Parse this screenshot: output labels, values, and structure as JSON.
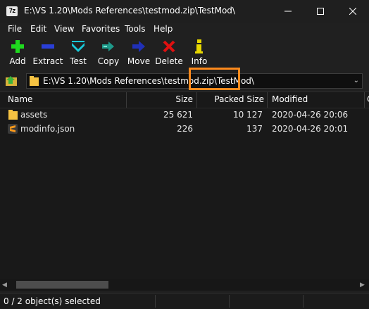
{
  "window": {
    "title": "E:\\VS 1.20\\Mods References\\testmod.zip\\TestMod\\",
    "app_icon_text": "7z"
  },
  "window_controls": {
    "minimize": "—",
    "maximize": "☐",
    "close": "✕"
  },
  "menu": [
    "File",
    "Edit",
    "View",
    "Favorites",
    "Tools",
    "Help"
  ],
  "toolbar": [
    {
      "label": "Add",
      "icon": "plus-icon",
      "color": "#1fd91f"
    },
    {
      "label": "Extract",
      "icon": "minus-icon",
      "color": "#2a3fd8"
    },
    {
      "label": "Test",
      "icon": "check-icon",
      "color": "#19c8d8"
    },
    {
      "label": "Copy",
      "icon": "double-arrow-icon",
      "color": "#1e9a8a"
    },
    {
      "label": "Move",
      "icon": "arrow-right-icon",
      "color": "#2030b8"
    },
    {
      "label": "Delete",
      "icon": "x-icon",
      "color": "#e01010"
    },
    {
      "label": "Info",
      "icon": "info-icon",
      "color": "#e8d800"
    }
  ],
  "address": {
    "path": "E:\\VS 1.20\\Mods References\\testmod.zip\\TestMod\\"
  },
  "columns": {
    "name": "Name",
    "size": "Size",
    "packed": "Packed Size",
    "modified": "Modified",
    "extra": "C"
  },
  "files": [
    {
      "name": "assets",
      "size": "25 621",
      "packed": "10 127",
      "modified": "2020-04-26 20:06",
      "icon": "folder-icon"
    },
    {
      "name": "modinfo.json",
      "size": "226",
      "packed": "137",
      "modified": "2020-04-26 20:01",
      "icon": "sublime-file-icon"
    }
  ],
  "status": {
    "selected": "0 / 2 object(s) selected"
  },
  "colors": {
    "highlight": "#ff8a1c",
    "folder": "#f5c242"
  }
}
